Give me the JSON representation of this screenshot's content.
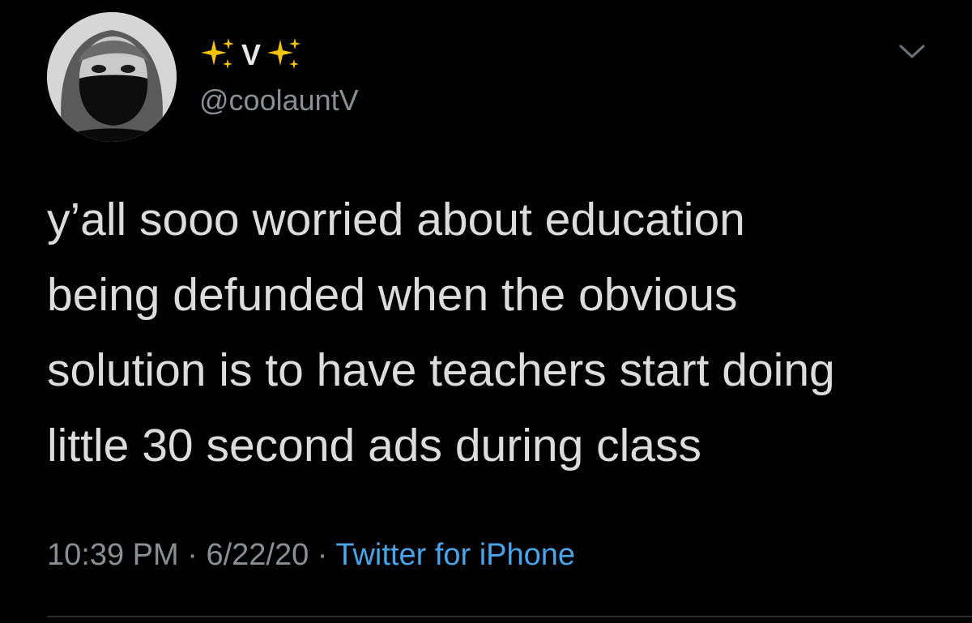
{
  "tweet": {
    "display_name": "V",
    "name_emoji_icon": "sparkles-icon",
    "handle": "@coolauntV",
    "text": "y’all sooo worried about education\nbeing defunded when the obvious\nsolution is to have teachers start doing\nlittle 30 second ads during class",
    "time": "10:39 PM",
    "separator": " · ",
    "date": "6/22/20",
    "source": "Twitter for iPhone",
    "more_icon": "chevron-down-icon"
  },
  "colors": {
    "background": "#000000",
    "text": "#dcdcdc",
    "secondary_text": "#8b8f94",
    "link": "#4aa4e8",
    "sparkle": "#f5c400"
  }
}
